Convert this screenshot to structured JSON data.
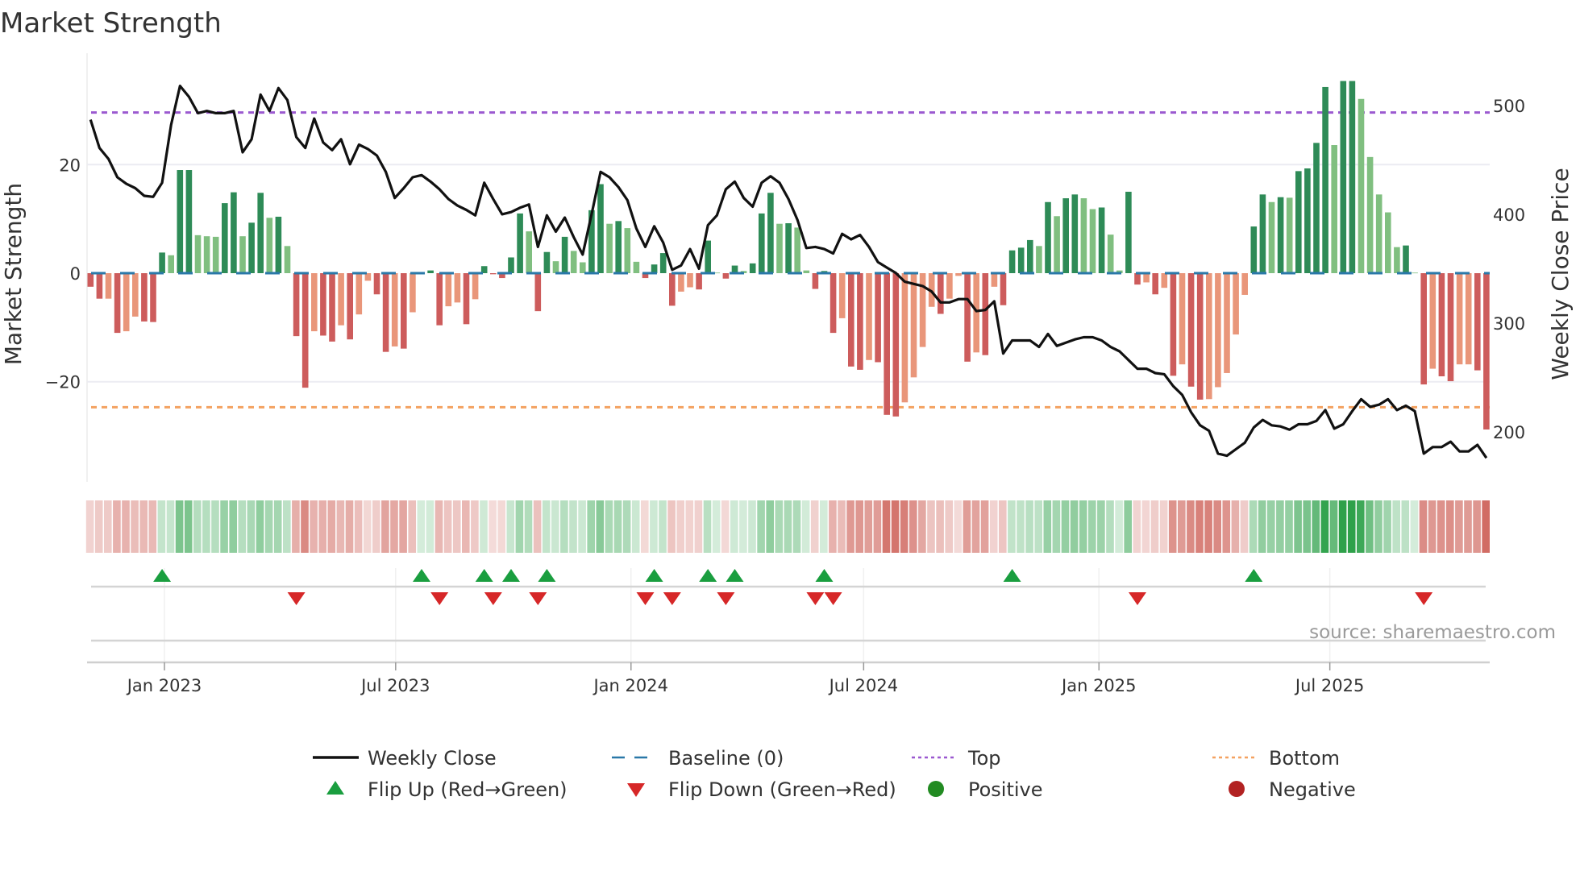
{
  "chart_data": {
    "type": "bar",
    "title": "Market Strength",
    "ylabel": "Market Strength",
    "ylabel_right": "Weekly Close Price",
    "ylim": [
      -38.3,
      38.3
    ],
    "ylim_right": [
      154,
      537
    ],
    "yticks": [
      {
        "value": 20,
        "label": "20"
      },
      {
        "value": 0,
        "label": "0"
      },
      {
        "value": -20,
        "label": "−20"
      }
    ],
    "yticks_right": [
      {
        "value": 500,
        "label": "500"
      },
      {
        "value": 400,
        "label": "400"
      },
      {
        "value": 300,
        "label": "300"
      },
      {
        "value": 200,
        "label": "200"
      }
    ],
    "xticks": [
      {
        "week": 8.26,
        "label": "Jan 2023"
      },
      {
        "week": 34.1,
        "label": "Jul 2023"
      },
      {
        "week": 60.4,
        "label": "Jan 2024"
      },
      {
        "week": 86.4,
        "label": "Jul 2024"
      },
      {
        "week": 112.7,
        "label": "Jan 2025"
      },
      {
        "week": 138.5,
        "label": "Jul 2025"
      }
    ],
    "top_level": 29.6,
    "bottom_level": -24.7,
    "shade_key": {
      "G": "strong positive",
      "g": "weak positive",
      "R": "strong negative",
      "r": "weak negative"
    },
    "strength": [
      -2.5,
      -4.7,
      -4.7,
      -11.0,
      -10.7,
      -8.0,
      -8.9,
      -9.0,
      3.8,
      3.3,
      19.0,
      19.0,
      7.0,
      6.8,
      6.7,
      12.9,
      14.9,
      6.8,
      9.3,
      14.8,
      10.2,
      10.4,
      5.0,
      -11.6,
      -21.1,
      -10.7,
      -11.5,
      -12.6,
      -9.6,
      -12.2,
      -7.6,
      -1.4,
      -3.9,
      -14.5,
      -13.5,
      -13.9,
      -7.2,
      0.2,
      0.5,
      -9.6,
      -6.1,
      -5.4,
      -9.4,
      -4.8,
      1.3,
      -0.2,
      -0.9,
      2.9,
      11.0,
      7.7,
      -7.0,
      3.9,
      2.2,
      6.7,
      4.1,
      2.0,
      11.6,
      16.4,
      9.1,
      9.6,
      8.3,
      2.1,
      -0.9,
      1.6,
      3.7,
      -6.0,
      -3.4,
      -2.6,
      -3.0,
      6.0,
      0.1,
      -1.0,
      1.4,
      0.4,
      1.8,
      11.0,
      14.8,
      9.1,
      9.2,
      8.4,
      0.5,
      -2.9,
      0.4,
      -11.0,
      -8.3,
      -17.2,
      -17.8,
      -16.0,
      -16.4,
      -26.1,
      -26.4,
      -23.8,
      -19.2,
      -13.6,
      -6.2,
      -7.5,
      -4.7,
      -0.5,
      -16.3,
      -14.6,
      -15.1,
      -2.5,
      -5.9,
      4.2,
      4.7,
      6.1,
      5.0,
      13.1,
      10.5,
      13.8,
      14.5,
      13.8,
      11.8,
      12.1,
      7.1,
      0.5,
      15.0,
      -2.1,
      -1.7,
      -3.9,
      -2.7,
      -18.9,
      -16.8,
      -20.9,
      -23.3,
      -23.2,
      -21.0,
      -18.4,
      -11.3,
      -4.0,
      8.6,
      14.5,
      13.1,
      14.0,
      13.9,
      18.8,
      19.3,
      24.0,
      34.3,
      23.6,
      35.4,
      35.4,
      32.1,
      21.4,
      14.5,
      11.2,
      4.8,
      5.1,
      0.1,
      -20.5,
      -17.6,
      -19.0,
      -19.9,
      -16.8,
      -16.8,
      -17.9,
      -28.8
    ],
    "shade": "RRrRrrRRGgGGgggGGgGGgGgRRrRRrRrrRRrRrGGRrrRrGRRGGgRGgGggGGgGggRGGRrrRGgRGgGGGgGggRGRrRRrRRRrrrrRrrRrRrRGGGgGgGGggGggGRrRrRrRRrrrrrGGgGgGGGGgGGgggggGgRrRRrrRR",
    "weekly_close": [
      487,
      461,
      451,
      434,
      428,
      424,
      417,
      416,
      429,
      482,
      518,
      508,
      493,
      495,
      493,
      493,
      495,
      457,
      469,
      510,
      495,
      516,
      505,
      471,
      461,
      488,
      466,
      459,
      469,
      446,
      464,
      460,
      454,
      439,
      415,
      424,
      434,
      436,
      430,
      423,
      414,
      408,
      404,
      399,
      429,
      414,
      400,
      402,
      406,
      409,
      370,
      399,
      384,
      397,
      379,
      363,
      400,
      439,
      434,
      425,
      413,
      387,
      370,
      389,
      374,
      349,
      353,
      368,
      350,
      390,
      399,
      423,
      430,
      415,
      407,
      429,
      435,
      429,
      414,
      395,
      369,
      370,
      368,
      364,
      382,
      377,
      381,
      370,
      356,
      351,
      346,
      338,
      336,
      334,
      329,
      319,
      319,
      322,
      322,
      311,
      312,
      320,
      272,
      284,
      284,
      284,
      278,
      290,
      279,
      282,
      285,
      287,
      287,
      284,
      278,
      274,
      266,
      258,
      258,
      254,
      253,
      242,
      234,
      218,
      206,
      201,
      180,
      178,
      184,
      190,
      204,
      211,
      206,
      205,
      202,
      207,
      207,
      210,
      220,
      203,
      207,
      219,
      230,
      223,
      225,
      230,
      220,
      224,
      219,
      180,
      186,
      186,
      191,
      182,
      182,
      188,
      176
    ],
    "flip_up_weeks": [
      8,
      37,
      44,
      47,
      51,
      63,
      69,
      72,
      82,
      103,
      130
    ],
    "flip_down_weeks": [
      23,
      39,
      45,
      50,
      62,
      65,
      71,
      81,
      83,
      117,
      149
    ],
    "legend": {
      "weekly_close": "Weekly Close",
      "baseline": "Baseline (0)",
      "top": "Top",
      "bottom": "Bottom",
      "flip_up": "Flip Up (Red→Green)",
      "flip_down": "Flip Down (Green→Red)",
      "positive": "Positive",
      "negative": "Negative"
    },
    "legend_placement": "bottom-center",
    "source": "source: sharemaestro.com"
  },
  "colors": {
    "strong_green": "#2e8b57",
    "weak_green": "#80bf80",
    "strong_red": "#cd5c5c",
    "weak_red": "#e9967a",
    "baseline": "#2a78a8",
    "top": "#9b59d0",
    "bottom": "#f4a261",
    "flip_up": "#1a9e3f",
    "flip_down": "#d62728",
    "positive": "#228b22",
    "negative": "#b22222",
    "line": "#111111"
  }
}
